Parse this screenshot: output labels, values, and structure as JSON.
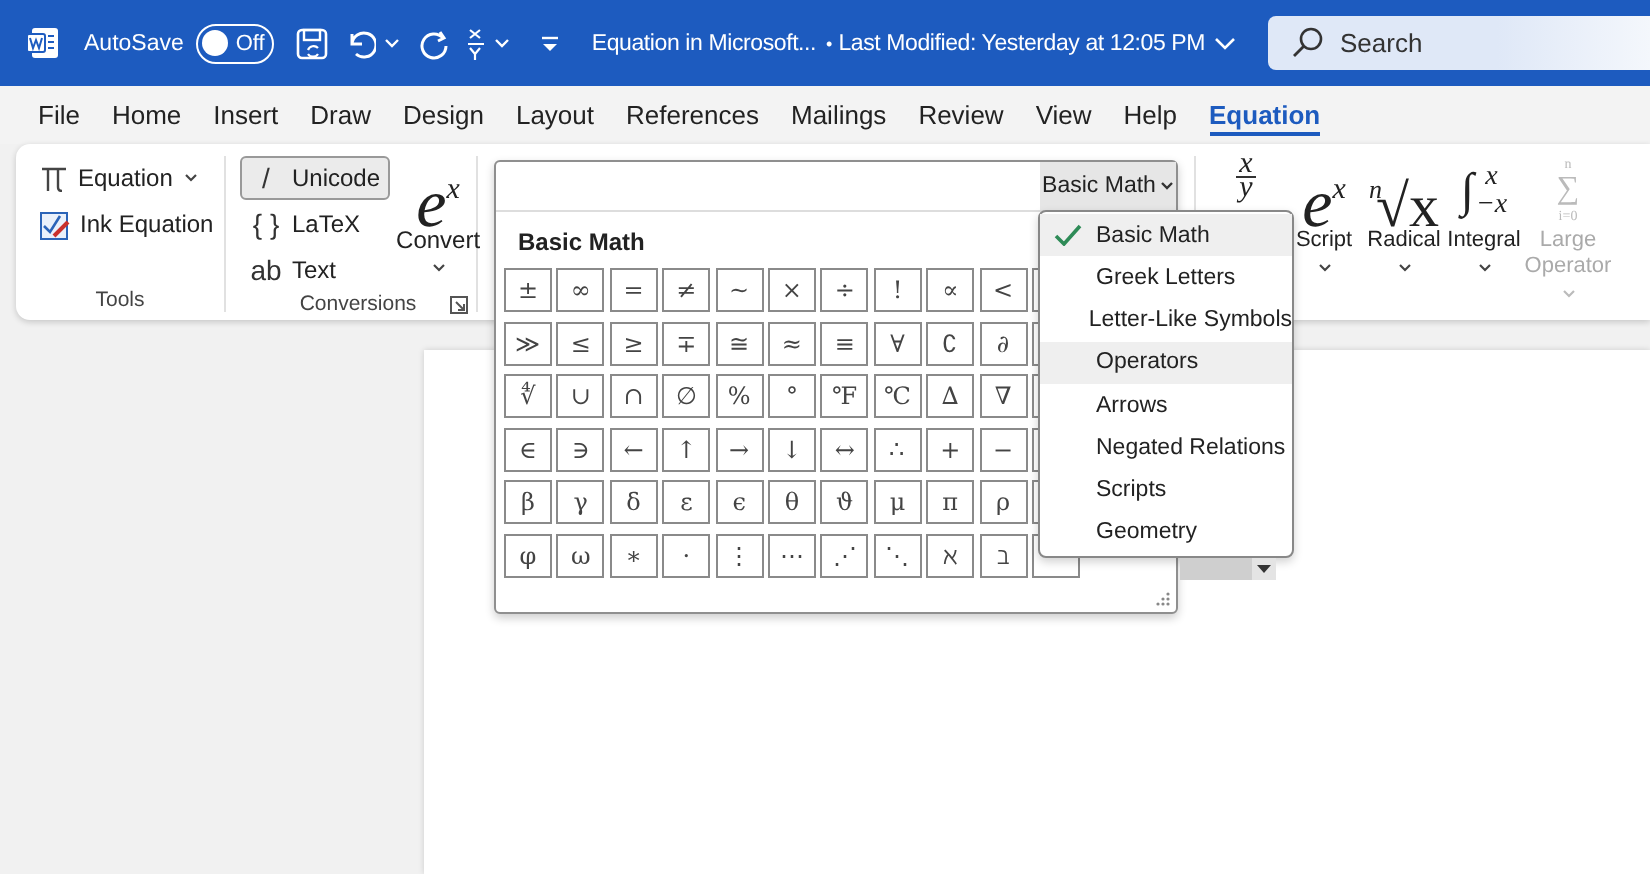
{
  "title_bar": {
    "autosave_label": "AutoSave",
    "autosave": {
      "on": false,
      "label": "Off"
    },
    "document_title": "Equation in Microsoft...",
    "separator": "•",
    "last_modified": "Last Modified: Yesterday at 12:05 PM",
    "search": {
      "placeholder": "Search"
    }
  },
  "tabs": [
    {
      "label": "File",
      "selected": false
    },
    {
      "label": "Home",
      "selected": false
    },
    {
      "label": "Insert",
      "selected": false
    },
    {
      "label": "Draw",
      "selected": false
    },
    {
      "label": "Design",
      "selected": false
    },
    {
      "label": "Layout",
      "selected": false
    },
    {
      "label": "References",
      "selected": false
    },
    {
      "label": "Mailings",
      "selected": false
    },
    {
      "label": "Review",
      "selected": false
    },
    {
      "label": "View",
      "selected": false
    },
    {
      "label": "Help",
      "selected": false
    },
    {
      "label": "Equation",
      "selected": true
    }
  ],
  "ribbon": {
    "tools": {
      "label": "Tools",
      "items": [
        {
          "kind": "dropdown",
          "label": "Equation"
        },
        {
          "kind": "button",
          "label": "Ink Equation"
        }
      ]
    },
    "conversions": {
      "label": "Conversions",
      "options": [
        {
          "icon": "/",
          "label": "Unicode",
          "selected": true
        },
        {
          "icon": "{ }",
          "label": "LaTeX",
          "selected": false
        },
        {
          "icon": "ab",
          "label": "Text",
          "selected": false
        }
      ],
      "convert": {
        "base": "e",
        "sup": "x",
        "label": "Convert"
      }
    },
    "structures": [
      {
        "kind": "fraction",
        "num": "x",
        "den": "y",
        "disabled": false
      },
      {
        "kind": "script",
        "base": "e",
        "sup": "x",
        "label": "Script",
        "disabled": false
      },
      {
        "kind": "radical",
        "index": "n",
        "base": "√x",
        "label": "Radical",
        "disabled": false
      },
      {
        "kind": "integral",
        "base": "∫",
        "sup": "x",
        "sub": "−x",
        "label": "Integral",
        "disabled": false
      },
      {
        "kind": "large-operator",
        "base": "∑",
        "sup": "n",
        "sub": "i=0",
        "label": "Large Operator",
        "disabled": true
      }
    ]
  },
  "gallery": {
    "category_button": "Basic Math",
    "heading": "Basic Math",
    "symbols": [
      [
        "±",
        "∞",
        "=",
        "≠",
        "~",
        "×",
        "÷",
        "!",
        "∝",
        "<"
      ],
      [
        "≫",
        "≤",
        "≥",
        "∓",
        "≅",
        "≈",
        "≡",
        "∀",
        "∁",
        "∂"
      ],
      [
        "∜",
        "∪",
        "∩",
        "∅",
        "%",
        "°",
        "℉",
        "℃",
        "∆",
        "∇"
      ],
      [
        "∈",
        "∋",
        "←",
        "↑",
        "→",
        "↓",
        "↔",
        "∴",
        "+",
        "−"
      ],
      [
        "β",
        "γ",
        "δ",
        "ε",
        "ϵ",
        "θ",
        "ϑ",
        "μ",
        "π",
        "ρ"
      ],
      [
        "φ",
        "ω",
        "∗",
        "·",
        "⋮",
        "⋯",
        "⋰",
        "⋱",
        "ℵ",
        "ℶ"
      ]
    ]
  },
  "category_menu": [
    {
      "label": "Basic Math",
      "selected": true,
      "highlighted": true
    },
    {
      "label": "Greek Letters",
      "selected": false,
      "highlighted": false
    },
    {
      "label": "Letter-Like Symbols",
      "selected": false,
      "highlighted": false
    },
    {
      "label": "Operators",
      "selected": false,
      "highlighted": true
    },
    {
      "label": "Arrows",
      "selected": false,
      "highlighted": false
    },
    {
      "label": "Negated Relations",
      "selected": false,
      "highlighted": false
    },
    {
      "label": "Scripts",
      "selected": false,
      "highlighted": false
    },
    {
      "label": "Geometry",
      "selected": false,
      "highlighted": false
    }
  ]
}
